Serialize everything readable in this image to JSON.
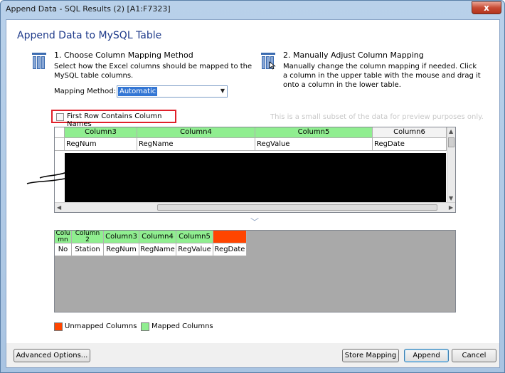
{
  "window": {
    "title": "Append Data - SQL Results (2) [A1:F7323]",
    "close_glyph": "x"
  },
  "dialog": {
    "heading": "Append Data to MySQL Table"
  },
  "step1": {
    "title": "1. Choose Column Mapping Method",
    "desc_line1": "Select how the Excel columns should be mapped to the",
    "desc_line2": "MySQL table columns.",
    "icon": "table-mapping-icon"
  },
  "step2": {
    "title": "2. Manually Adjust Column Mapping",
    "desc_line1": "Manually change the column mapping if needed. Click",
    "desc_line2": "a column in the upper table with the mouse and drag it",
    "desc_line3": "onto a column in the lower table.",
    "icon": "table-drag-icon"
  },
  "mapping": {
    "label": "Mapping Method:",
    "selected": "Automatic"
  },
  "first_row": {
    "label": "First Row Contains Column Names",
    "checked": false
  },
  "preview_note": "This is a small subset of the data for preview purposes only.",
  "upper_grid": {
    "headers": [
      "Column3",
      "Column4",
      "Column5",
      "Column6"
    ],
    "header_colors": [
      "#90ee90",
      "#90ee90",
      "#90ee90",
      "#f3f3f3"
    ],
    "subheaders": [
      "RegNum",
      "RegName",
      "RegValue",
      "RegDate"
    ]
  },
  "lower_grid": {
    "headers": [
      "Colu\nmn",
      "Column\n2",
      "Column3",
      "Column4",
      "Column5",
      ""
    ],
    "columns": [
      "No",
      "Station",
      "RegNum",
      "RegName",
      "RegValue",
      "RegDate"
    ]
  },
  "legend": {
    "unmapped_label": "Unmapped Columns",
    "unmapped_color": "#ff4500",
    "mapped_label": "Mapped Columns",
    "mapped_color": "#90ee90"
  },
  "buttons": {
    "advanced": "Advanced Options...",
    "store": "Store Mapping",
    "append": "Append",
    "cancel": "Cancel"
  }
}
